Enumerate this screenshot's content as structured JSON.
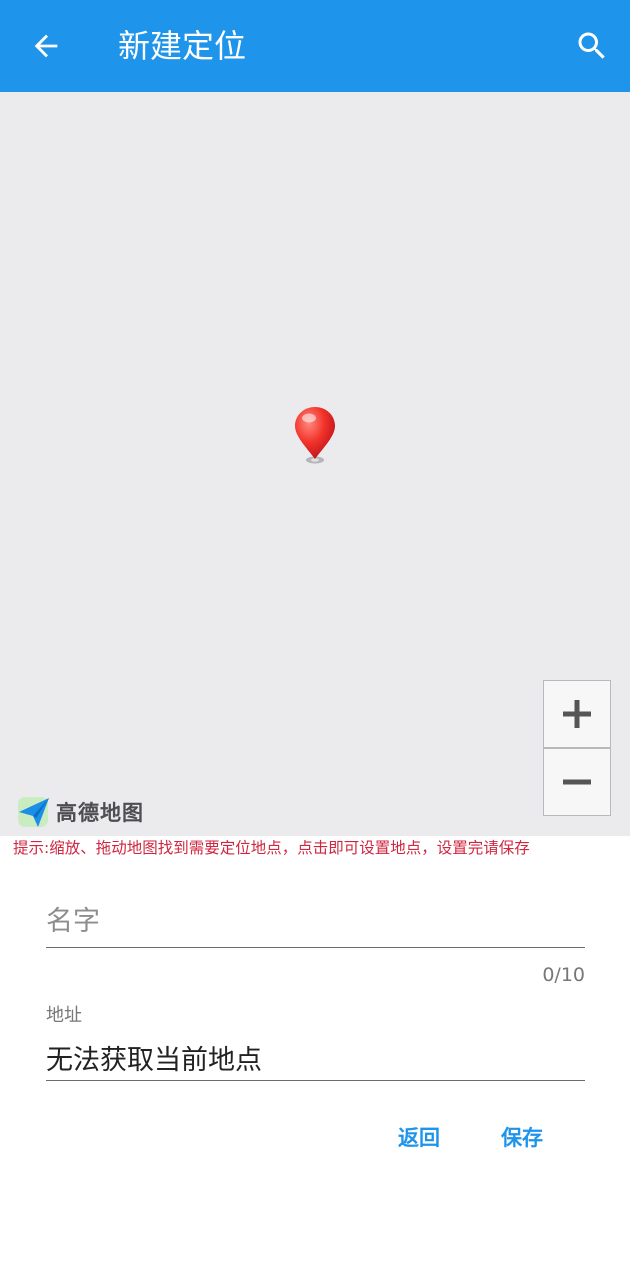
{
  "appbar": {
    "title": "新建定位",
    "back_icon": "arrow-left-icon",
    "search_icon": "search-icon",
    "color": "#1e94ea"
  },
  "map": {
    "background": "#ebebee",
    "marker_icon": "map-pin-icon",
    "zoom_in_label": "+",
    "zoom_out_label": "−",
    "provider_logo_text": "高德地图"
  },
  "hint": {
    "text": "提示:缩放、拖动地图找到需要定位地点，点击即可设置地点，设置完请保存",
    "color": "#d0263f"
  },
  "form": {
    "name_placeholder": "名字",
    "name_value": "",
    "name_counter": "0/10",
    "address_label": "地址",
    "address_value": "无法获取当前地点"
  },
  "actions": {
    "back_label": "返回",
    "save_label": "保存"
  }
}
